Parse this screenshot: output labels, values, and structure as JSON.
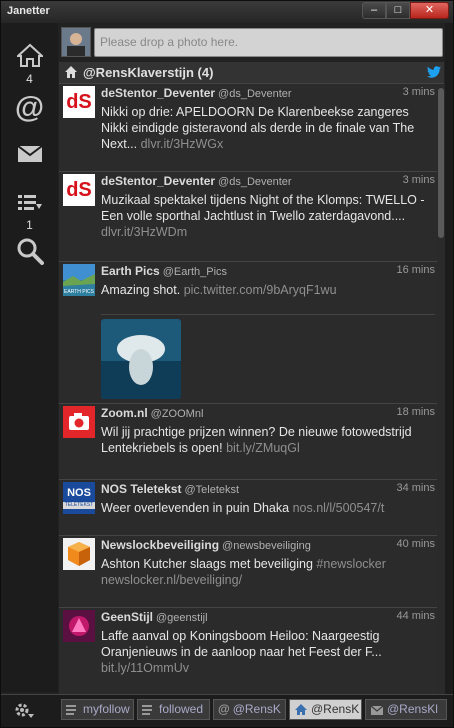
{
  "app": {
    "title": "Janetter"
  },
  "window": {
    "min": "–",
    "max": "□",
    "close": "✕"
  },
  "nav": {
    "home_count": "4",
    "lists_count": "1"
  },
  "compose": {
    "placeholder": "Please drop a photo here."
  },
  "column": {
    "title": "@RensKlaverstijn (4)"
  },
  "tweets": [
    {
      "name": "deStentor_Deventer",
      "handle": "@ds_Deventer",
      "time": "3 mins",
      "text": "Nikki op drie: APELDOORN De Klarenbeekse zangeres Nikki eindigde gisteravond als derde in de finale van The Next...",
      "link": "dlvr.it/3HzWGx",
      "avatar_text": "dS"
    },
    {
      "name": "deStentor_Deventer",
      "handle": "@ds_Deventer",
      "time": "3 mins",
      "text": "Muzikaal spektakel tijdens Night of the Klomps: TWELLO - Een volle sporthal Jachtlust in Twello zaterdagavond....",
      "link": "dlvr.it/3HzWDm",
      "avatar_text": "dS"
    },
    {
      "name": "Earth Pics",
      "handle": "@Earth_Pics",
      "time": "16 mins",
      "text": "Amazing shot.",
      "link": "pic.twitter.com/9bAryqF1wu",
      "avatar_text": "EARTH PICS"
    },
    {
      "name": "Zoom.nl",
      "handle": "@ZOOMnl",
      "time": "18 mins",
      "text": "Wil jij prachtige prijzen winnen? De nieuwe fotowedstrijd Lentekriebels is open!",
      "link": "bit.ly/ZMuqGl"
    },
    {
      "name": "NOS Teletekst",
      "handle": "@Teletekst",
      "time": "34 mins",
      "text": "Weer overlevenden in puin Dhaka",
      "link": "nos.nl/l/500547/t",
      "avatar_text": "NOS",
      "avatar_sub": "TELETEKST"
    },
    {
      "name": "Newslockbeveiliging",
      "handle": "@newsbeveiliging",
      "time": "40 mins",
      "text": "Ashton Kutcher slaags met beveiliging",
      "hashtag": "#newslocker",
      "link": "newslocker.nl/beveiliging/"
    },
    {
      "name": "GeenStijl",
      "handle": "@geenstijl",
      "time": "44 mins",
      "text": "Laffe aanval op Koningsboom Heiloo: Naargeestig Oranjenieuws in de aanloop naar het Feest der F...",
      "link": "bit.ly/11OmmUv"
    }
  ],
  "bottom_tabs": [
    {
      "label": "myfollow"
    },
    {
      "label": "followed"
    },
    {
      "label": "@RensK"
    },
    {
      "label": "@RensK"
    },
    {
      "label": "@RensKl"
    }
  ],
  "colors": {
    "twitter_blue": "#1da1f2",
    "zoom_red": "#e3262a",
    "nos_blue": "#1a4a9c"
  }
}
